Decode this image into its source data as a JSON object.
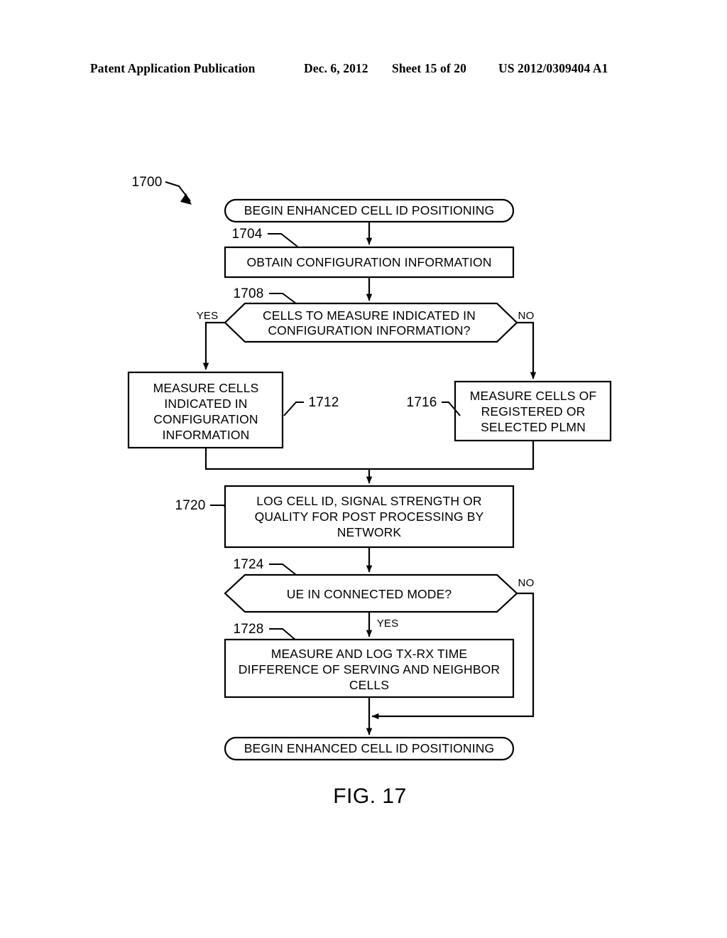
{
  "header": {
    "publication": "Patent Application Publication",
    "date": "Dec. 6, 2012",
    "sheet": "Sheet 15 of 20",
    "number": "US 2012/0309404 A1"
  },
  "figure": {
    "caption": "FIG. 17",
    "diagram_ref": "1700"
  },
  "nodes": {
    "start": {
      "ref": "",
      "label": "BEGIN ENHANCED CELL ID POSITIONING",
      "shape": "terminator"
    },
    "obtain_config": {
      "ref": "1704",
      "label": "OBTAIN CONFIGURATION INFORMATION",
      "shape": "process"
    },
    "cells_decision": {
      "ref": "1708",
      "line1": "CELLS TO MEASURE INDICATED IN",
      "line2": "CONFIGURATION INFORMATION?",
      "shape": "decision",
      "yes_label": "YES",
      "no_label": "NO"
    },
    "measure_indicated": {
      "ref": "1712",
      "line1": "MEASURE CELLS",
      "line2": "INDICATED IN",
      "line3": "CONFIGURATION",
      "line4": "INFORMATION",
      "shape": "process"
    },
    "measure_plmn": {
      "ref": "1716",
      "line1": "MEASURE CELLS OF",
      "line2": "REGISTERED OR",
      "line3": "SELECTED PLMN",
      "shape": "process"
    },
    "log_cell": {
      "ref": "1720",
      "line1": "LOG CELL ID, SIGNAL STRENGTH OR",
      "line2": "QUALITY FOR POST PROCESSING BY",
      "line3": "NETWORK",
      "shape": "process"
    },
    "connected_decision": {
      "ref": "1724",
      "label": "UE IN CONNECTED MODE?",
      "shape": "decision",
      "yes_label": "YES",
      "no_label": "NO"
    },
    "measure_txrx": {
      "ref": "1728",
      "line1": "MEASURE AND LOG TX-RX TIME",
      "line2": "DIFFERENCE OF SERVING AND NEIGHBOR",
      "line3": "CELLS",
      "shape": "process"
    },
    "end": {
      "ref": "",
      "label": "BEGIN ENHANCED CELL ID POSITIONING",
      "shape": "terminator"
    }
  },
  "colors": {
    "ink": "#000000",
    "paper": "#ffffff"
  }
}
